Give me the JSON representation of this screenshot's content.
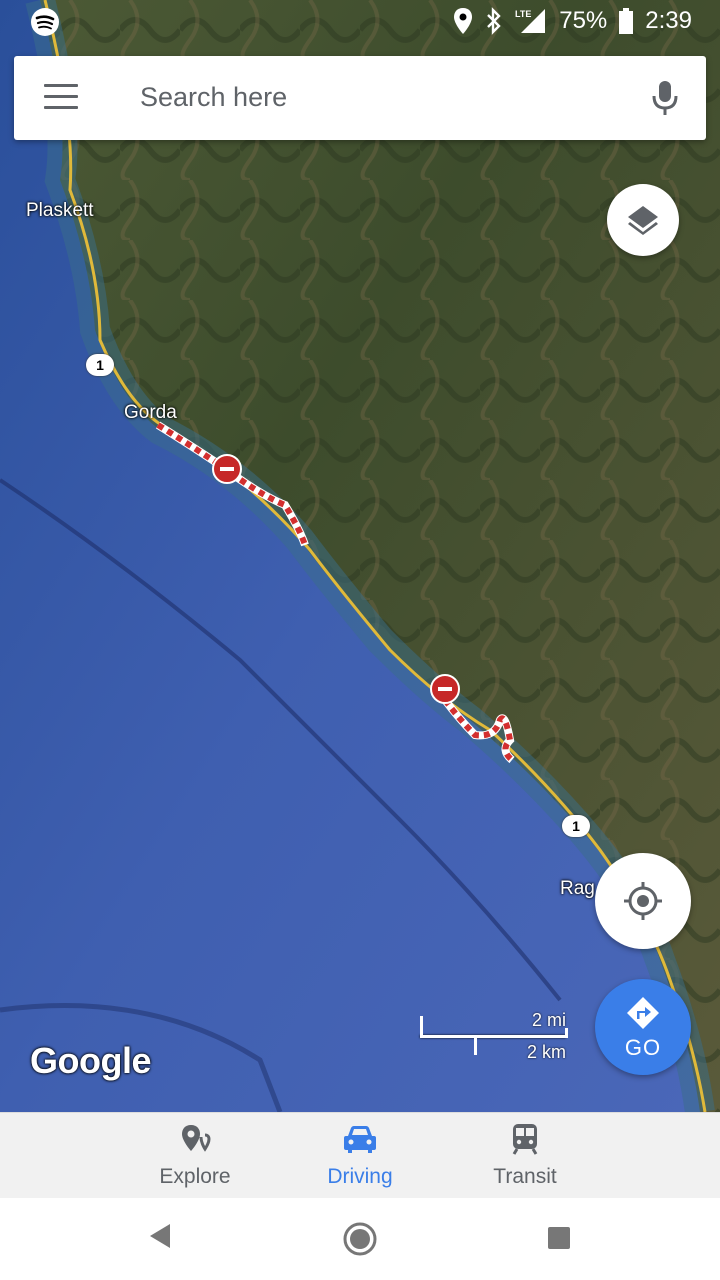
{
  "status": {
    "battery": "75%",
    "time": "2:39",
    "network": "LTE"
  },
  "search": {
    "placeholder": "Search here"
  },
  "map": {
    "labels": {
      "plaskett": "Plaskett",
      "gorda": "Gorda",
      "ragged": "Rag"
    },
    "route_shield": "1",
    "scale_mi": "2 mi",
    "scale_km": "2 km",
    "logo": "Google"
  },
  "fab": {
    "go_label": "GO"
  },
  "nav": {
    "explore": "Explore",
    "driving": "Driving",
    "transit": "Transit"
  },
  "colors": {
    "accent": "#3a7ee8",
    "closure": "#c62828"
  }
}
